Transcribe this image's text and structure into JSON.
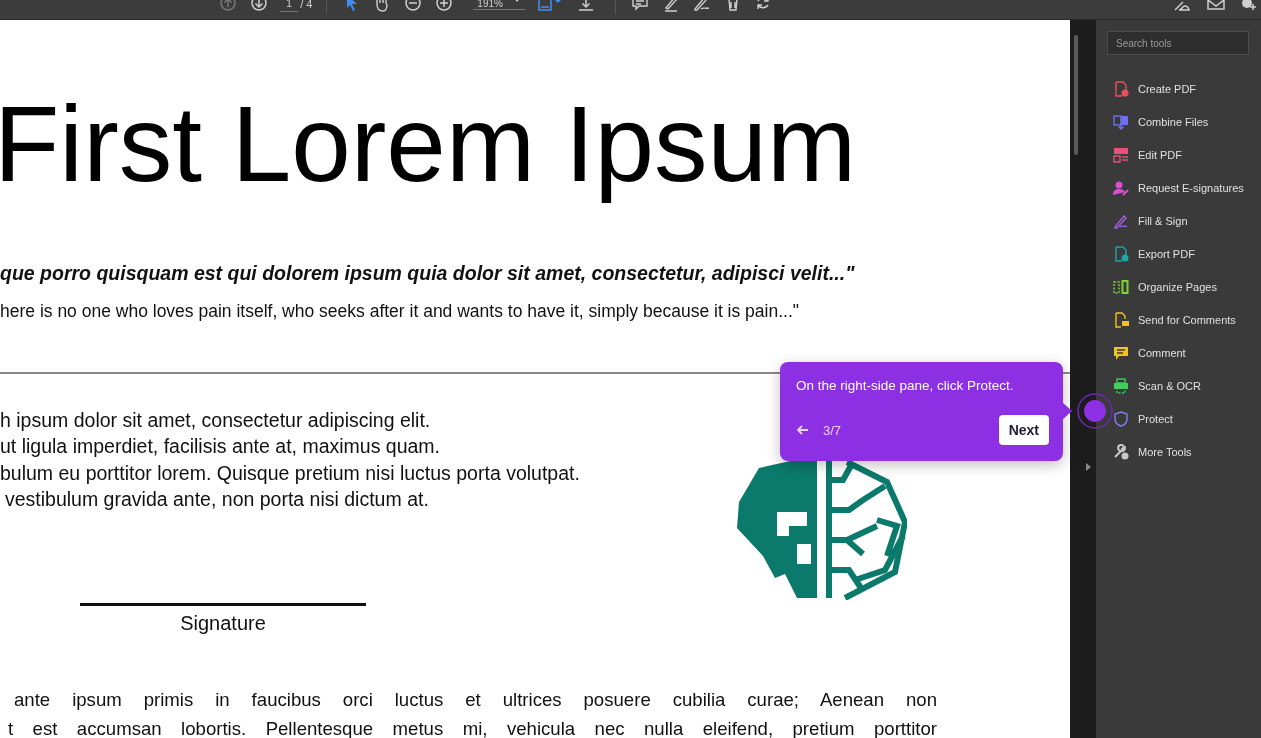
{
  "toolbar": {
    "page": "1",
    "page_total": "/ 4",
    "zoom": "191%"
  },
  "document": {
    "title": "First Lorem Ipsum",
    "quote": "que porro quisquam est qui dolorem ipsum quia dolor sit amet, consectetur, adipisci velit...\"",
    "translation": "here is no one who loves pain itself, who seeks after it and wants to have it, simply because it is pain...\"",
    "paragraph_lines": [
      "h ipsum dolor sit amet, consectetur adipiscing elit.",
      "ut ligula imperdiet, facilisis ante at, maximus quam.",
      "bulum eu porttitor lorem. Quisque pretium nisi luctus porta volutpat.",
      "vestibulum gravida ante, non porta nisi dictum at."
    ],
    "signature_label": "Signature",
    "body_lines": [
      "ante ipsum primis in faucibus orci luctus et ultrices posuere cubilia curae; Aenean non",
      "t est accumsan lobortis. Pellentesque metus mi, vehicula nec nulla eleifend, pretium porttitor"
    ]
  },
  "sidebar": {
    "search": {
      "placeholder": "Search tools"
    },
    "tools": [
      {
        "label": "Create PDF",
        "kind": "create",
        "color": "#e8505b"
      },
      {
        "label": "Combine Files",
        "kind": "combine",
        "color": "#6f6ff0"
      },
      {
        "label": "Edit PDF",
        "kind": "edit",
        "color": "#e8507f"
      },
      {
        "label": "Request E-signatures",
        "kind": "request",
        "color": "#d94fd0"
      },
      {
        "label": "Fill & Sign",
        "kind": "fill",
        "color": "#a35ee0"
      },
      {
        "label": "Export PDF",
        "kind": "export",
        "color": "#17a8a8"
      },
      {
        "label": "Organize Pages",
        "kind": "organize",
        "color": "#7fd13b"
      },
      {
        "label": "Send for Comments",
        "kind": "send",
        "color": "#f0c419"
      },
      {
        "label": "Comment",
        "kind": "comment",
        "color": "#f0c419"
      },
      {
        "label": "Scan & OCR",
        "kind": "scan",
        "color": "#3fcf5a"
      },
      {
        "label": "Protect",
        "kind": "protect",
        "color": "#7f7ff5"
      },
      {
        "label": "More Tools",
        "kind": "more",
        "color": "#c8c8c8"
      }
    ]
  },
  "guide": {
    "text": "On the right-side pane, click Protect.",
    "step": "3/7",
    "button": "Next"
  }
}
